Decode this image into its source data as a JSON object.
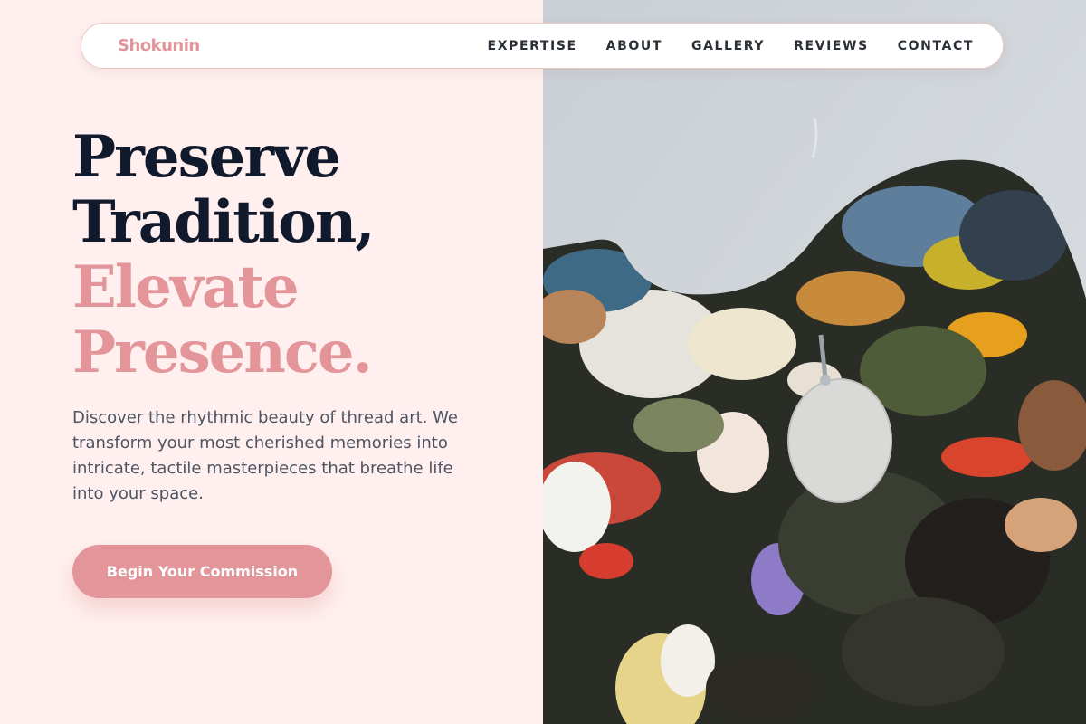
{
  "nav": {
    "brand": "Shokunin",
    "links": [
      {
        "label": "EXPERTISE"
      },
      {
        "label": "ABOUT"
      },
      {
        "label": "GALLERY"
      },
      {
        "label": "REVIEWS"
      },
      {
        "label": "CONTACT"
      }
    ]
  },
  "hero": {
    "title_lines": [
      "Preserve",
      "Tradition,"
    ],
    "accent_lines": [
      "Elevate",
      "Presence."
    ],
    "description": "Discover the rhythmic beauty of thread art. We transform your most cherished memories into intricate, tactile masterpieces that breathe life into your space.",
    "cta_label": "Begin Your Commission"
  },
  "image": {
    "icon": "paint-palette-photo"
  },
  "colors": {
    "accent": "#e39599",
    "background_left": "#fff0ef",
    "heading": "#111a2c",
    "body_text": "#4d5563"
  }
}
